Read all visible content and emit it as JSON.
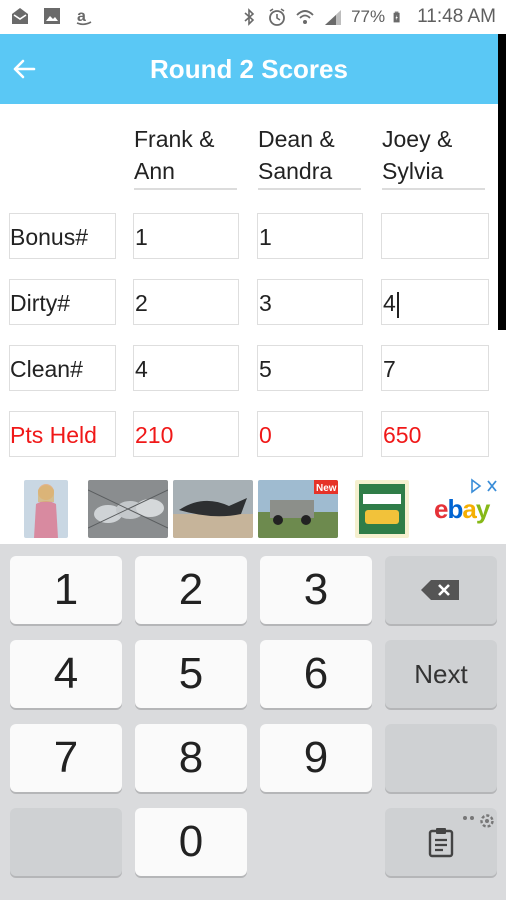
{
  "status_bar": {
    "battery_percent": "77%",
    "time": "11:48 AM"
  },
  "app_bar": {
    "title": "Round 2 Scores"
  },
  "teams": [
    {
      "line1": "Frank &",
      "line2": "Ann"
    },
    {
      "line1": "Dean &",
      "line2": "Sandra"
    },
    {
      "line1": "Joey &",
      "line2": "Sylvia"
    }
  ],
  "rows": [
    {
      "label": "Bonus#",
      "values": [
        "1",
        "1",
        ""
      ]
    },
    {
      "label": "Dirty#",
      "values": [
        "2",
        "3",
        "4"
      ]
    },
    {
      "label": "Clean#",
      "values": [
        "4",
        "5",
        "7"
      ]
    },
    {
      "label": "Pts Held",
      "values": [
        "210",
        "0",
        "650"
      ]
    }
  ],
  "ad": {
    "badge_new": "New",
    "brand": {
      "e": "e",
      "b": "b",
      "a": "a",
      "y": "y"
    },
    "brand_colors": {
      "e": "#e53238",
      "b": "#0064d2",
      "a": "#f5af02",
      "y": "#86b817"
    }
  },
  "keyboard": {
    "keys": [
      "1",
      "2",
      "3",
      "4",
      "5",
      "6",
      "7",
      "8",
      "9",
      "0"
    ],
    "next_label": "Next"
  },
  "colors": {
    "app_bar": "#5ac8f5",
    "pts_held": "#f01818"
  }
}
